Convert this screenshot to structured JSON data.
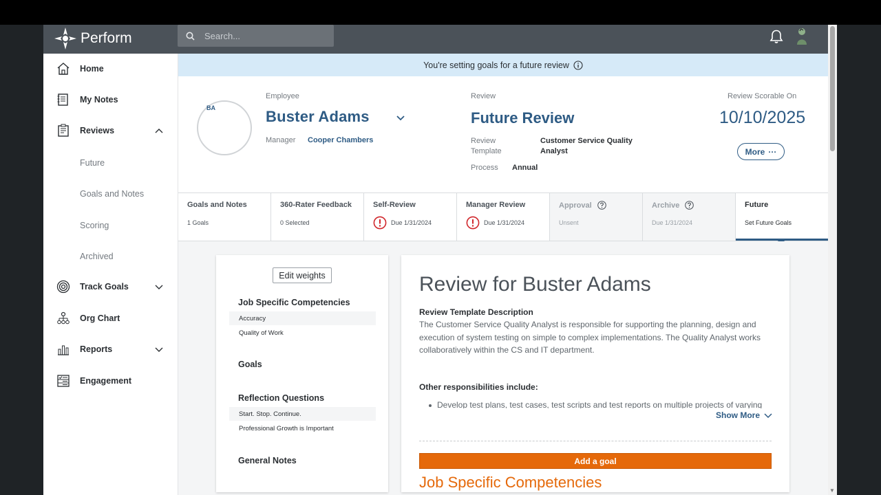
{
  "app": {
    "name": "Perform"
  },
  "search": {
    "placeholder": "Search..."
  },
  "sidebar": {
    "items": [
      {
        "label": "Home"
      },
      {
        "label": "My Notes"
      },
      {
        "label": "Reviews"
      },
      {
        "label": "Track Goals"
      },
      {
        "label": "Org Chart"
      },
      {
        "label": "Reports"
      },
      {
        "label": "Engagement"
      }
    ],
    "reviews_sub": [
      "Future",
      "Goals and Notes",
      "Scoring",
      "Archived"
    ]
  },
  "banner": {
    "text": "You're setting goals for a future review"
  },
  "employee": {
    "label": "Employee",
    "initials": "BA",
    "name": "Buster Adams",
    "manager_label": "Manager",
    "manager": "Cooper Chambers"
  },
  "review": {
    "label": "Review",
    "name": "Future Review",
    "template_label_1": "Review",
    "template_label_2": "Template",
    "template_1": "Customer Service Quality",
    "template_2": "Analyst",
    "process_label": "Process",
    "process": "Annual"
  },
  "scorable": {
    "label": "Review Scorable On",
    "date": "10/10/2025",
    "more": "More",
    "more_dots": "···"
  },
  "tabs": [
    {
      "title": "Goals and Notes",
      "sub": "1 Goals"
    },
    {
      "title": "360-Rater Feedback",
      "sub": "0 Selected"
    },
    {
      "title": "Self-Review",
      "sub": "Due 1/31/2024"
    },
    {
      "title": "Manager Review",
      "sub": "Due 1/31/2024"
    },
    {
      "title": "Approval",
      "sub": "Unsent"
    },
    {
      "title": "Archive",
      "sub": "Due 1/31/2024"
    },
    {
      "title": "Future",
      "sub": "Set Future Goals"
    }
  ],
  "leftpanel": {
    "edit_weights": "Edit weights",
    "jsc": "Job Specific Competencies",
    "jsc_items": [
      "Accuracy",
      "Quality of Work"
    ],
    "goals": "Goals",
    "reflection": "Reflection Questions",
    "reflection_items": [
      "Start. Stop. Continue.",
      "Professional Growth is Important"
    ],
    "general_notes": "General Notes"
  },
  "main": {
    "title": "Review for Buster Adams",
    "desc_heading": "Review Template Description",
    "desc": "The Customer Service Quality Analyst is responsible for supporting the planning, design and execution of system testing on simple to complex implementations. The Quality Analyst works collaboratively within the CS and IT department.",
    "other_heading": "Other responsibilities include:",
    "bullet_1": "Develop test plans, test cases, test scripts and test reports on multiple projects of varying",
    "show_more": "Show More",
    "add_goal": "Add a goal",
    "section_title": "Job Specific Competencies"
  },
  "colors": {
    "topbar": "#4b5259",
    "brand_blue": "#2e5b84",
    "accent_orange": "#e5690a",
    "banner": "#d6eaf8",
    "warning_red": "#d0262b"
  }
}
